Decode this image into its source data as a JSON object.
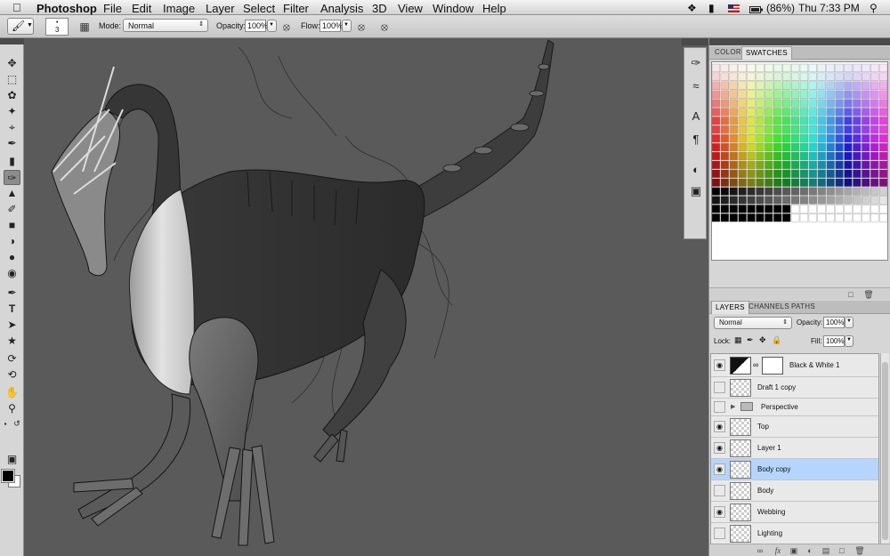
{
  "menubar": {
    "app": "Photoshop",
    "items": [
      "File",
      "Edit",
      "Image",
      "Layer",
      "Select",
      "Filter",
      "Analysis",
      "3D",
      "View",
      "Window",
      "Help"
    ],
    "battery": "(86%)",
    "clock": "Thu 7:33 PM"
  },
  "options": {
    "brush_size": "3",
    "mode_label": "Mode:",
    "mode_value": "Normal",
    "opacity_label": "Opacity:",
    "opacity_value": "100%",
    "flow_label": "Flow:",
    "flow_value": "100%"
  },
  "swatch_panel": {
    "tabs": [
      "COLOR",
      "SWATCHES"
    ],
    "active_tab": "SWATCHES"
  },
  "layers_panel": {
    "tabs": [
      "LAYERS",
      "CHANNELS",
      "PATHS"
    ],
    "active_tab": "LAYERS",
    "blend_mode": "Normal",
    "opacity_label": "Opacity:",
    "opacity_value": "100%",
    "lock_label": "Lock:",
    "fill_label": "Fill:",
    "fill_value": "100%",
    "layers": [
      {
        "name": "Black & White 1",
        "visible": true,
        "selected": false,
        "type": "adjustment"
      },
      {
        "name": "Draft 1 copy",
        "visible": false,
        "selected": false,
        "type": "layer"
      },
      {
        "name": "Perspective",
        "visible": false,
        "selected": false,
        "type": "group"
      },
      {
        "name": "Top",
        "visible": true,
        "selected": false,
        "type": "layer"
      },
      {
        "name": "Layer 1",
        "visible": true,
        "selected": false,
        "type": "layer"
      },
      {
        "name": "Body copy",
        "visible": true,
        "selected": true,
        "type": "layer"
      },
      {
        "name": "Body",
        "visible": false,
        "selected": false,
        "type": "layer"
      },
      {
        "name": "Webbing",
        "visible": true,
        "selected": false,
        "type": "layer"
      },
      {
        "name": "Lighting",
        "visible": false,
        "selected": false,
        "type": "layer"
      }
    ]
  }
}
